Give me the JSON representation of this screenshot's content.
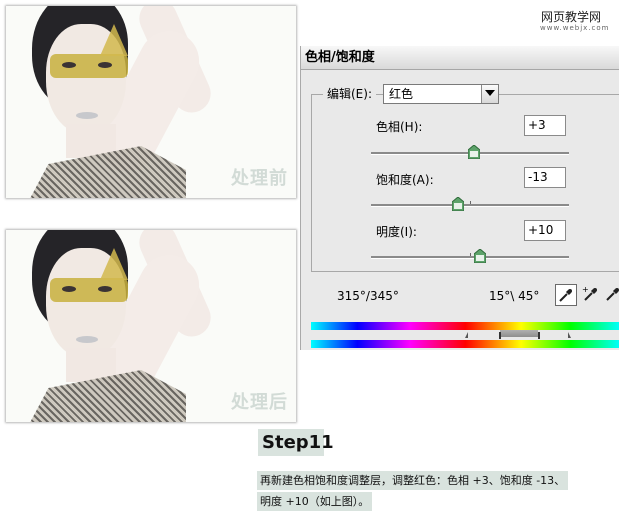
{
  "watermark": {
    "site": "网页教学网",
    "url": "www.webjx.com"
  },
  "photos": [
    {
      "label": "处理前"
    },
    {
      "label": "处理后"
    }
  ],
  "dialog": {
    "title": "色相/饱和度",
    "edit_label": "编辑(E):",
    "edit_value": "红色",
    "sliders": [
      {
        "label": "色相(H):",
        "value": "+3",
        "level": 0.5
      },
      {
        "label": "饱和度(A):",
        "value": "-13",
        "level": 0.44
      },
      {
        "label": "明度(I):",
        "value": "+10",
        "level": 0.55
      }
    ],
    "range_left": "315°/345°",
    "range_right": "15°\\ 45°",
    "tools": [
      "eyedropper-icon",
      "eyedropper-plus-icon",
      "eyedropper-minus-icon"
    ],
    "colors": {
      "accent": "#4e9a5c"
    }
  },
  "step": {
    "title": "Step11",
    "line1": "再新建色相饱和度调整层，调整红色：色相 +3、饱和度 -13、",
    "line2": "明度 +10（如上图）。"
  }
}
